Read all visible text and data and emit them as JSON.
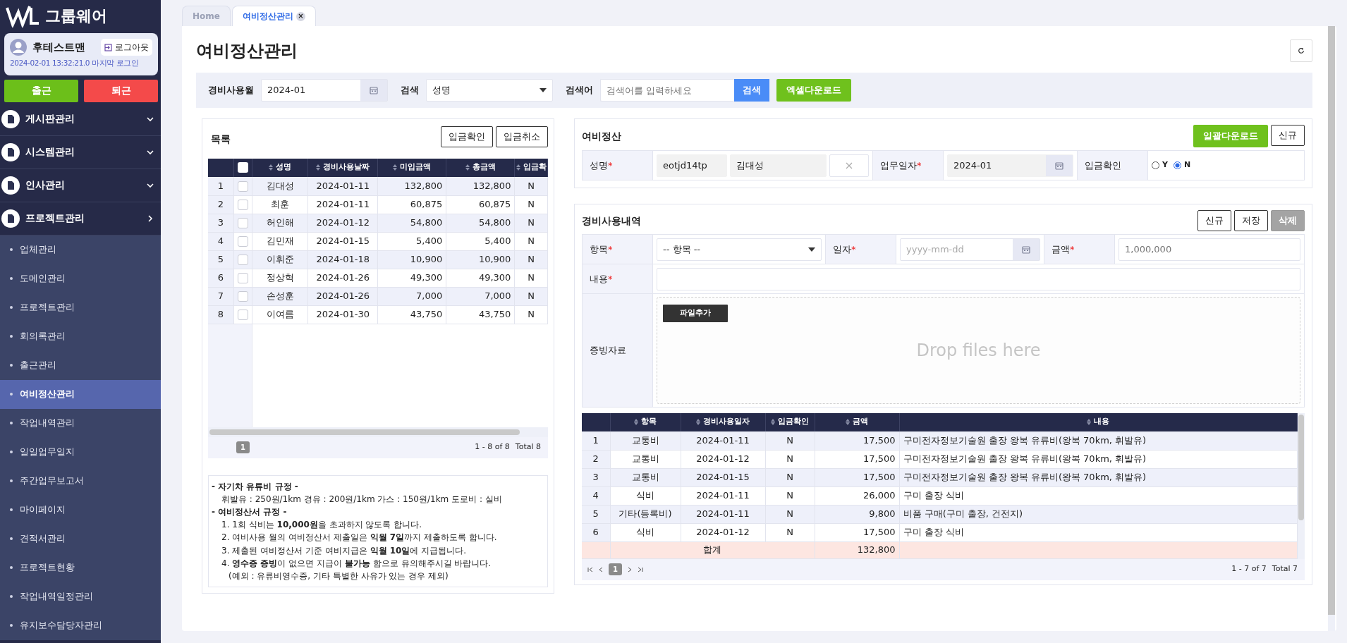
{
  "brand": {
    "name": "그룹웨어"
  },
  "user": {
    "name": "후테스트맨",
    "logout": "로그아웃",
    "last_login": "2024-02-01 13:32:21.0 마지막 로그인"
  },
  "attendance": [
    {
      "label": "출근",
      "kind": "in"
    },
    {
      "label": "퇴근",
      "kind": "out"
    }
  ],
  "sidebar": {
    "items": [
      {
        "label": "게시판관리",
        "expanded": false
      },
      {
        "label": "시스템관리",
        "expanded": false
      },
      {
        "label": "인사관리",
        "expanded": false
      },
      {
        "label": "프로젝트관리",
        "expanded": true,
        "children": [
          {
            "label": "업체관리",
            "selected": false
          },
          {
            "label": "도메인관리",
            "selected": false
          },
          {
            "label": "프로젝트관리",
            "selected": false
          },
          {
            "label": "회의록관리",
            "selected": false
          },
          {
            "label": "출근관리",
            "selected": false
          },
          {
            "label": "여비정산관리",
            "selected": true
          },
          {
            "label": "작업내역관리",
            "selected": false
          },
          {
            "label": "일일업무일지",
            "selected": false
          },
          {
            "label": "주간업무보고서",
            "selected": false
          },
          {
            "label": "마이페이지",
            "selected": false
          },
          {
            "label": "견적서관리",
            "selected": false
          },
          {
            "label": "프로젝트현황",
            "selected": false
          },
          {
            "label": "작업내역일정관리",
            "selected": false
          },
          {
            "label": "유지보수담당자관리",
            "selected": false
          }
        ]
      }
    ]
  },
  "tabs": [
    {
      "label": "Home",
      "selected": false
    },
    {
      "label": "여비정산관리",
      "selected": true,
      "close": "×"
    }
  ],
  "page_title": "여비정산관리",
  "search_bar": {
    "month_label": "경비사용월",
    "month_value": "2024-01",
    "search_label": "검색",
    "search_option": "성명",
    "keyword_label": "검색어",
    "keyword_placeholder": "검색어를 입력하세요",
    "search_button": "검색",
    "excel_button": "엑셀다운로드"
  },
  "list_panel": {
    "title": "목록",
    "buttons": [
      "입금확인",
      "입금취소"
    ],
    "select_all_checked": false,
    "columns": [
      "성명",
      "경비사용날짜",
      "미입금액",
      "총금액",
      "입금확"
    ],
    "rows": [
      {
        "no": "1",
        "checked": false,
        "name": "김대성",
        "date": "2024-01-11",
        "unpaid": "132,800",
        "total": "132,800",
        "confirmed": "N"
      },
      {
        "no": "2",
        "checked": false,
        "name": "최훈",
        "date": "2024-01-11",
        "unpaid": "60,875",
        "total": "60,875",
        "confirmed": "N"
      },
      {
        "no": "3",
        "checked": false,
        "name": "허인해",
        "date": "2024-01-12",
        "unpaid": "54,800",
        "total": "54,800",
        "confirmed": "N"
      },
      {
        "no": "4",
        "checked": false,
        "name": "김민재",
        "date": "2024-01-15",
        "unpaid": "5,400",
        "total": "5,400",
        "confirmed": "N"
      },
      {
        "no": "5",
        "checked": false,
        "name": "이휘준",
        "date": "2024-01-18",
        "unpaid": "10,900",
        "total": "10,900",
        "confirmed": "N"
      },
      {
        "no": "6",
        "checked": false,
        "name": "정상혁",
        "date": "2024-01-26",
        "unpaid": "49,300",
        "total": "49,300",
        "confirmed": "N"
      },
      {
        "no": "7",
        "checked": false,
        "name": "손성훈",
        "date": "2024-01-26",
        "unpaid": "7,000",
        "total": "7,000",
        "confirmed": "N"
      },
      {
        "no": "8",
        "checked": false,
        "name": "이여름",
        "date": "2024-01-30",
        "unpaid": "43,750",
        "total": "43,750",
        "confirmed": "N"
      }
    ],
    "pages": [
      {
        "label": "1",
        "selected": true
      }
    ],
    "summary": "1 - 8 of 8",
    "total": "Total 8"
  },
  "notice": [
    {
      "kind": "heading",
      "text": "- 자기차 유류비 규정 -"
    },
    {
      "kind": "line",
      "text": "휘발유 : 250원/1km 경유 : 200원/1km 가스 : 150원/1km 도로비 : 실비"
    },
    {
      "kind": "heading",
      "text": "- 여비정산서 규정 -"
    },
    {
      "kind": "item",
      "text": "1. 1회 식비는 **10,000원**을 초과하지 않도록 합니다."
    },
    {
      "kind": "item",
      "text": "2. 여비사용 월의 여비정산서 제출일은 **익월 7일**까지 제출하도록 합니다."
    },
    {
      "kind": "item",
      "text": "3. 제출된 여비정산서 기준 여비지급은 **익월 10일**에 지급됩니다."
    },
    {
      "kind": "item",
      "text": "4. **영수증 증빙**이 없으면 지급이 **불가능** 함으로 유의해주시길 바랍니다."
    },
    {
      "kind": "note",
      "text": "(예외 : 유류비영수증, 기타 특별한 사유가 있는 경우 제외)"
    }
  ],
  "settlement": {
    "title": "여비정산",
    "buttons": [
      {
        "label": "일괄다운로드",
        "kind": "green"
      },
      {
        "label": "신규",
        "kind": "outline"
      }
    ],
    "name_label": {
      "text": "성명",
      "required_mark": "*"
    },
    "user_id": "eotjd14tp",
    "user_name": "김대성",
    "work_date_label": {
      "text": "업무일자",
      "required_mark": "*"
    },
    "work_date": "2024-01",
    "deposit_label": {
      "text": "입금확인"
    },
    "deposit_options": [
      {
        "label": "Y",
        "selected": false
      },
      {
        "label": "N",
        "selected": true
      }
    ]
  },
  "expenses": {
    "title": "경비사용내역",
    "buttons": [
      {
        "label": "신규",
        "disabled": false
      },
      {
        "label": "저장",
        "disabled": false
      },
      {
        "label": "삭제",
        "disabled": true
      }
    ],
    "item_label": {
      "text": "항목",
      "required_mark": "*"
    },
    "item_placeholder": "-- 항목 --",
    "date_label": {
      "text": "일자",
      "required_mark": "*"
    },
    "date_placeholder": "yyyy-mm-dd",
    "amount_label": {
      "text": "금액",
      "required_mark": "*"
    },
    "amount_placeholder": "1,000,000",
    "content_label": {
      "text": "내용",
      "required_mark": "*"
    },
    "evidence_label": {
      "text": "증빙자료"
    },
    "add_file": "파일추가",
    "drop_text": "Drop files here",
    "columns": [
      "항목",
      "경비사용일자",
      "입금확인",
      "금액",
      "내용"
    ],
    "rows": [
      {
        "no": "1",
        "item": "교통비",
        "date": "2024-01-11",
        "confirmed": "N",
        "amount": "17,500",
        "content": "구미전자정보기술원 출장 왕복 유류비(왕복 70km, 휘발유)"
      },
      {
        "no": "2",
        "item": "교통비",
        "date": "2024-01-12",
        "confirmed": "N",
        "amount": "17,500",
        "content": "구미전자정보기술원 출장 왕복 유류비(왕복 70km, 휘발유)"
      },
      {
        "no": "3",
        "item": "교통비",
        "date": "2024-01-15",
        "confirmed": "N",
        "amount": "17,500",
        "content": "구미전자정보기술원 출장 왕복 유류비(왕복 70km, 휘발유)"
      },
      {
        "no": "4",
        "item": "식비",
        "date": "2024-01-11",
        "confirmed": "N",
        "amount": "26,000",
        "content": "구미 출장 식비"
      },
      {
        "no": "5",
        "item": "기타(등록비)",
        "date": "2024-01-11",
        "confirmed": "N",
        "amount": "9,800",
        "content": "비품 구매(구미 출장, 건전지)"
      },
      {
        "no": "6",
        "item": "식비",
        "date": "2024-01-12",
        "confirmed": "N",
        "amount": "17,500",
        "content": "구미 출장 식비"
      }
    ],
    "sum_label": "합계",
    "sum_amount": "132,800",
    "pages": [
      {
        "label": "1",
        "selected": true
      }
    ],
    "summary": "1 - 7 of 7",
    "total": "Total 7"
  }
}
